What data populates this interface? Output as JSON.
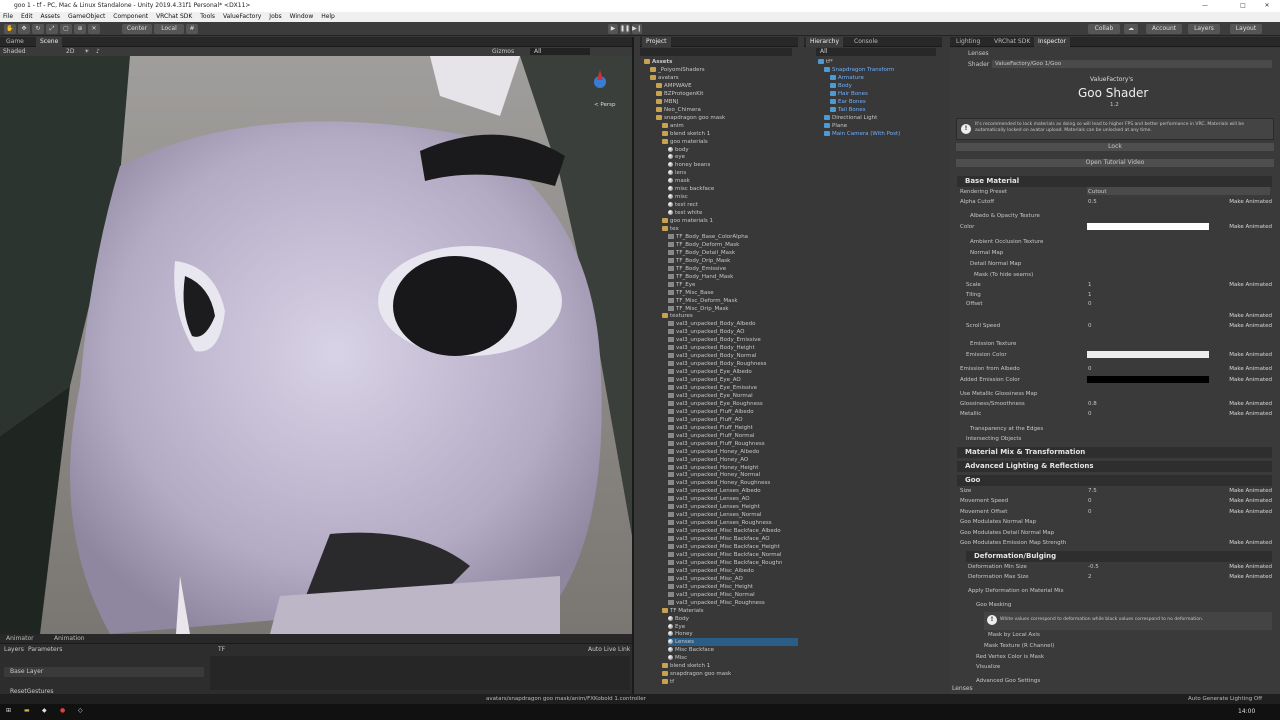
{
  "titlebar": {
    "text": "goo 1 - tf - PC, Mac & Linux Standalone - Unity 2019.4.31f1 Personal* <DX11>"
  },
  "menu": [
    "File",
    "Edit",
    "Assets",
    "GameObject",
    "Component",
    "VRChat SDK",
    "Tools",
    "ValueFactory",
    "Jobs",
    "Window",
    "Help"
  ],
  "toolbar": {
    "center": "Center",
    "local": "Local",
    "collab": "Collab",
    "account": "Account",
    "layers": "Layers",
    "layout": "Layout"
  },
  "scene": {
    "tab_game": "Game",
    "tab_scene": "Scene",
    "shading": "Shaded",
    "mode_2d": "2D",
    "gizmos": "Gizmos",
    "search": "All",
    "persp": "< Persp"
  },
  "project": {
    "tab": "Project",
    "root": "Assets",
    "items": [
      {
        "label": "_PoiyomiShaders",
        "type": "fold",
        "indent": 1
      },
      {
        "label": "avatars",
        "type": "fold",
        "indent": 1
      },
      {
        "label": "AMPWAVE",
        "type": "fold",
        "indent": 2
      },
      {
        "label": "BZProtogenKit",
        "type": "fold",
        "indent": 2
      },
      {
        "label": "MBNJ",
        "type": "fold",
        "indent": 2
      },
      {
        "label": "Neo_Chimera",
        "type": "fold",
        "indent": 2
      },
      {
        "label": "snapdragon goo mask",
        "type": "fold",
        "indent": 2
      },
      {
        "label": "anim",
        "type": "fold",
        "indent": 3
      },
      {
        "label": "blend sketch 1",
        "type": "fold",
        "indent": 3
      },
      {
        "label": "goo materials",
        "type": "fold",
        "indent": 3
      },
      {
        "label": "body",
        "type": "mat",
        "indent": 4
      },
      {
        "label": "eye",
        "type": "mat",
        "indent": 4
      },
      {
        "label": "honey beans",
        "type": "mat",
        "indent": 4
      },
      {
        "label": "lens",
        "type": "mat",
        "indent": 4
      },
      {
        "label": "mask",
        "type": "mat",
        "indent": 4
      },
      {
        "label": "misc backface",
        "type": "mat",
        "indent": 4
      },
      {
        "label": "misc",
        "type": "mat",
        "indent": 4
      },
      {
        "label": "test rect",
        "type": "mat",
        "indent": 4
      },
      {
        "label": "test white",
        "type": "mat",
        "indent": 4
      },
      {
        "label": "goo materials 1",
        "type": "fold",
        "indent": 3
      },
      {
        "label": "tex",
        "type": "fold",
        "indent": 3
      },
      {
        "label": "TF_Body_Base_ColorAlpha",
        "type": "tex",
        "indent": 4
      },
      {
        "label": "TF_Body_Deform_Mask",
        "type": "tex",
        "indent": 4
      },
      {
        "label": "TF_Body_Detail_Mask",
        "type": "tex",
        "indent": 4
      },
      {
        "label": "TF_Body_Drip_Mask",
        "type": "tex",
        "indent": 4
      },
      {
        "label": "TF_Body_Emissive",
        "type": "tex",
        "indent": 4
      },
      {
        "label": "TF_Body_Hand_Mask",
        "type": "tex",
        "indent": 4
      },
      {
        "label": "TF_Eye",
        "type": "tex",
        "indent": 4
      },
      {
        "label": "TF_Misc_Base",
        "type": "tex",
        "indent": 4
      },
      {
        "label": "TF_Misc_Deform_Mask",
        "type": "tex",
        "indent": 4
      },
      {
        "label": "TF_Misc_Drip_Mask",
        "type": "tex",
        "indent": 4
      },
      {
        "label": "textures",
        "type": "fold",
        "indent": 3
      },
      {
        "label": "val3_unpacked_Body_Albedo",
        "type": "tex",
        "indent": 4
      },
      {
        "label": "val3_unpacked_Body_AO",
        "type": "tex",
        "indent": 4
      },
      {
        "label": "val3_unpacked_Body_Emissive",
        "type": "tex",
        "indent": 4
      },
      {
        "label": "val3_unpacked_Body_Height",
        "type": "tex",
        "indent": 4
      },
      {
        "label": "val3_unpacked_Body_Normal",
        "type": "tex",
        "indent": 4
      },
      {
        "label": "val3_unpacked_Body_Roughness",
        "type": "tex",
        "indent": 4
      },
      {
        "label": "val3_unpacked_Eye_Albedo",
        "type": "tex",
        "indent": 4
      },
      {
        "label": "val3_unpacked_Eye_AO",
        "type": "tex",
        "indent": 4
      },
      {
        "label": "val3_unpacked_Eye_Emissive",
        "type": "tex",
        "indent": 4
      },
      {
        "label": "val3_unpacked_Eye_Normal",
        "type": "tex",
        "indent": 4
      },
      {
        "label": "val3_unpacked_Eye_Roughness",
        "type": "tex",
        "indent": 4
      },
      {
        "label": "val3_unpacked_Fluff_Albedo",
        "type": "tex",
        "indent": 4
      },
      {
        "label": "val3_unpacked_Fluff_AO",
        "type": "tex",
        "indent": 4
      },
      {
        "label": "val3_unpacked_Fluff_Height",
        "type": "tex",
        "indent": 4
      },
      {
        "label": "val3_unpacked_Fluff_Normal",
        "type": "tex",
        "indent": 4
      },
      {
        "label": "val3_unpacked_Fluff_Roughness",
        "type": "tex",
        "indent": 4
      },
      {
        "label": "val3_unpacked_Honey_Albedo",
        "type": "tex",
        "indent": 4
      },
      {
        "label": "val3_unpacked_Honey_AO",
        "type": "tex",
        "indent": 4
      },
      {
        "label": "val3_unpacked_Honey_Height",
        "type": "tex",
        "indent": 4
      },
      {
        "label": "val3_unpacked_Honey_Normal",
        "type": "tex",
        "indent": 4
      },
      {
        "label": "val3_unpacked_Honey_Roughness",
        "type": "tex",
        "indent": 4
      },
      {
        "label": "val3_unpacked_Lenses_Albedo",
        "type": "tex",
        "indent": 4
      },
      {
        "label": "val3_unpacked_Lenses_AO",
        "type": "tex",
        "indent": 4
      },
      {
        "label": "val3_unpacked_Lenses_Height",
        "type": "tex",
        "indent": 4
      },
      {
        "label": "val3_unpacked_Lenses_Normal",
        "type": "tex",
        "indent": 4
      },
      {
        "label": "val3_unpacked_Lenses_Roughness",
        "type": "tex",
        "indent": 4
      },
      {
        "label": "val3_unpacked_Misc Backface_Albedo",
        "type": "tex",
        "indent": 4
      },
      {
        "label": "val3_unpacked_Misc Backface_AO",
        "type": "tex",
        "indent": 4
      },
      {
        "label": "val3_unpacked_Misc Backface_Height",
        "type": "tex",
        "indent": 4
      },
      {
        "label": "val3_unpacked_Misc Backface_Normal",
        "type": "tex",
        "indent": 4
      },
      {
        "label": "val3_unpacked_Misc Backface_Roughn",
        "type": "tex",
        "indent": 4
      },
      {
        "label": "val3_unpacked_Misc_Albedo",
        "type": "tex",
        "indent": 4
      },
      {
        "label": "val3_unpacked_Misc_AO",
        "type": "tex",
        "indent": 4
      },
      {
        "label": "val3_unpacked_Misc_Height",
        "type": "tex",
        "indent": 4
      },
      {
        "label": "val3_unpacked_Misc_Normal",
        "type": "tex",
        "indent": 4
      },
      {
        "label": "val3_unpacked_Misc_Roughness",
        "type": "tex",
        "indent": 4
      },
      {
        "label": "TF Materials",
        "type": "fold",
        "indent": 3
      },
      {
        "label": "Body",
        "type": "mat",
        "indent": 4
      },
      {
        "label": "Eye",
        "type": "mat",
        "indent": 4
      },
      {
        "label": "Honey",
        "type": "mat",
        "indent": 4
      },
      {
        "label": "Lenses",
        "type": "mat",
        "indent": 4,
        "selected": true
      },
      {
        "label": "Misc Backface",
        "type": "mat",
        "indent": 4
      },
      {
        "label": "Misc",
        "type": "mat",
        "indent": 4
      },
      {
        "label": "blend sketch 1",
        "type": "fold",
        "indent": 3
      },
      {
        "label": "snapdragon goo mask",
        "type": "fold",
        "indent": 3
      },
      {
        "label": "tf",
        "type": "fold",
        "indent": 3
      }
    ],
    "footer": "avatars/snapdragon goo mask/anim/FXKobold 1.controller"
  },
  "hierarchy": {
    "tab_hierarchy": "Hierarchy",
    "tab_console": "Console",
    "search": "All",
    "items": [
      {
        "label": "tf*",
        "indent": 0
      },
      {
        "label": "Snapdragon Transform",
        "indent": 1,
        "blue": true
      },
      {
        "label": "Armature",
        "indent": 2,
        "blue": true
      },
      {
        "label": "Body",
        "indent": 2,
        "blue": true
      },
      {
        "label": "Hair Bones",
        "indent": 2,
        "blue": true
      },
      {
        "label": "Ear Bones",
        "indent": 2,
        "blue": true
      },
      {
        "label": "Tail Bones",
        "indent": 2,
        "blue": true
      },
      {
        "label": "Directional Light",
        "indent": 1
      },
      {
        "label": "Plane",
        "indent": 1
      },
      {
        "label": "Main Camera (With Post)",
        "indent": 1,
        "blue": true
      }
    ]
  },
  "inspector": {
    "tabs": [
      "Lighting",
      "VRChat SDK",
      "Inspector"
    ],
    "material_name": "Lenses",
    "shader_label": "Shader",
    "shader_value": "ValueFactory/Goo 1/Goo",
    "brand": "ValueFactory's",
    "title": "Goo Shader",
    "version": "1.2",
    "info": "It's recommended to lock materials as doing so will lead to higher FPS and better performance in VRC. Materials will be automatically locked on avatar upload. Materials can be unlocked at any time.",
    "lock_button": "Lock",
    "tutorial_button": "Open Tutorial Video",
    "make_animated": "Make Animated",
    "sections": {
      "base": "Base Material",
      "mix": "Material Mix & Transformation",
      "advanced": "Advanced Lighting & Reflections",
      "goo": "Goo",
      "deform": "Deformation/Bulging"
    },
    "rows": {
      "rendering_preset": {
        "label": "Rendering Preset",
        "value": "Cutout"
      },
      "alpha_cutoff": {
        "label": "Alpha Cutoff",
        "value": "0.5"
      },
      "albedo": "Albedo & Opacity Texture",
      "color": "Color",
      "ao": "Ambient Occlusion Texture",
      "normal": "Normal Map",
      "detail_normal": "Detail Normal Map",
      "mask_hide": "Mask (To hide seams)",
      "scale": {
        "label": "Scale",
        "value": "1"
      },
      "tiling": {
        "label": "Tiling",
        "x": "1",
        "y": "1"
      },
      "offset": {
        "label": "Offset",
        "x": "0",
        "y": "0"
      },
      "scroll": {
        "label": "Scroll Speed",
        "x": "0",
        "y": "0.005"
      },
      "emission_tex": "Emission Texture",
      "emission_color": {
        "label": "Emission Color",
        "value": "HDR"
      },
      "emission_albedo": {
        "label": "Emission from Albedo",
        "value": "0"
      },
      "added_emission": {
        "label": "Added Emission Color",
        "value": "HDR"
      },
      "metal_gloss": "Use Metallic Glossiness Map",
      "gloss": {
        "label": "Glossiness/Smoothness",
        "value": "0.8"
      },
      "metallic": {
        "label": "Metallic",
        "value": "0"
      },
      "transparency": "Transparency at the Edges",
      "intersecting": "Intersecting Objects",
      "size": {
        "label": "Size",
        "value": "7.5"
      },
      "move_speed": {
        "label": "Movement Speed",
        "x": "0",
        "y": "0.5",
        "z": "0.5"
      },
      "move_offset": {
        "label": "Movement Offset",
        "x": "0",
        "y": "0",
        "z": "0"
      },
      "mod_normal": "Goo Modulates Normal Map",
      "mod_detail": "Goo Modulates Detail Normal Map",
      "mod_emission": "Goo Modulates Emission Map Strength",
      "def_min": {
        "label": "Deformation Min Size",
        "value": "-0.5"
      },
      "def_max": {
        "label": "Deformation Max Size",
        "value": "2"
      },
      "apply_def": "Apply Deformation on Material Mix",
      "goo_masking": "Goo Masking",
      "mask_info": "White values correspond to deformation while black values correspond to no deformation.",
      "mask_local": "Mask by Local Axis",
      "mask_tex": "Mask Texture (R Channel)",
      "red_vertex": "Red Vertex Color is Mask",
      "visualize": "Visualize",
      "adv_goo": "Advanced Goo Settings"
    },
    "footer": "Lenses"
  },
  "animator": {
    "tab_animator": "Animator",
    "tab_animation": "Animation",
    "layers": "Layers",
    "parameters": "Parameters",
    "base_layer": "Base Layer",
    "reset": "ResetGestures",
    "tf": "TF",
    "auto_live": "Auto Live Link"
  },
  "status": {
    "right": "Auto Generate Lighting Off"
  },
  "taskbar": {
    "time": "14:00"
  }
}
